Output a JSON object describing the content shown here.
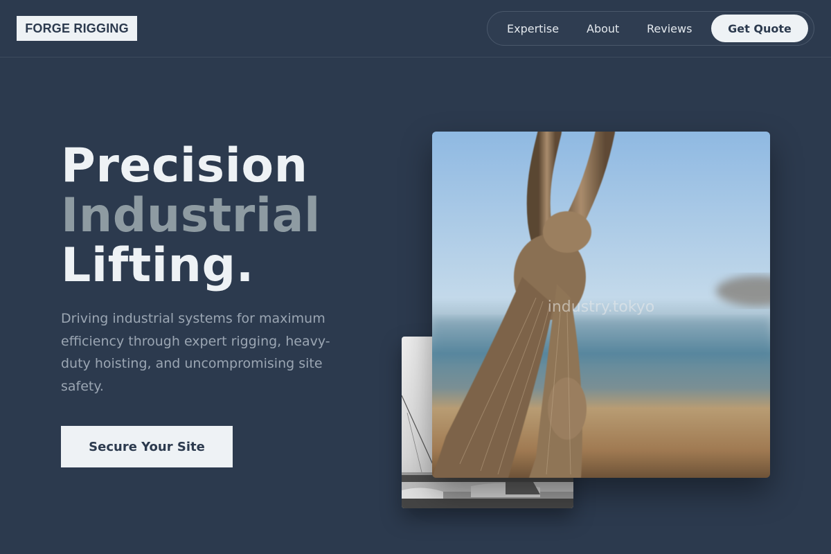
{
  "brand": {
    "logo_text": "FORGE RIGGING"
  },
  "nav": {
    "links": [
      {
        "label": "Expertise"
      },
      {
        "label": "About"
      },
      {
        "label": "Reviews"
      }
    ],
    "cta_label": "Get Quote"
  },
  "hero": {
    "headline": [
      "Precision",
      "Industrial",
      "Lifting."
    ],
    "description": "Driving industrial systems for maximum efficiency through expert rigging, heavy-duty hoisting, and uncompromising site safety.",
    "cta_label": "Secure Your Site"
  },
  "images": {
    "main_photo": {
      "subject": "frayed knotted rope against blurred beach",
      "watermark": "industry.tokyo"
    },
    "secondary_photo": {
      "subject": "black-and-white harbor with sailboats"
    }
  },
  "colors": {
    "background": "#2c3a4e",
    "light": "#eef2f5",
    "muted_heading": "#8e9ba2",
    "body_text": "#9ba6b3"
  }
}
